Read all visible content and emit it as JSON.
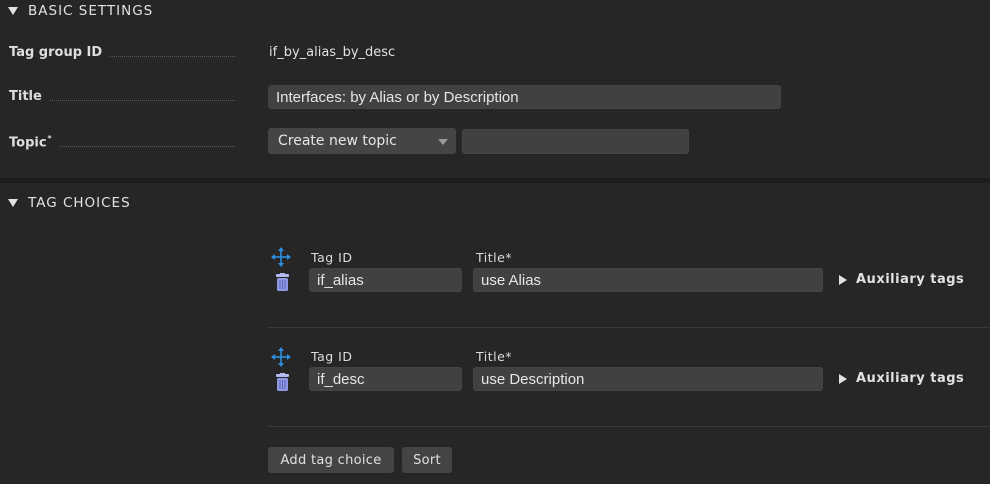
{
  "basic_settings": {
    "header": "BASIC SETTINGS",
    "tag_group_id": {
      "label": "Tag group ID",
      "value": "if_by_alias_by_desc"
    },
    "title": {
      "label": "Title",
      "value": "Interfaces: by Alias or by Description"
    },
    "topic": {
      "label": "Topic",
      "required_mark": "*",
      "select_value": "Create new topic",
      "input_value": ""
    }
  },
  "tag_choices": {
    "header": "TAG CHOICES",
    "tag_id_label": "Tag ID",
    "title_label": "Title*",
    "aux_label": "Auxiliary tags",
    "choices": [
      {
        "tag_id": "if_alias",
        "title": "use Alias"
      },
      {
        "tag_id": "if_desc",
        "title": "use Description"
      }
    ],
    "add_button": "Add tag choice",
    "sort_button": "Sort"
  },
  "icons": {
    "move": "move-arrows-icon",
    "delete": "trash-icon"
  },
  "colors": {
    "background": "#262626",
    "input_bg": "#414141",
    "accent_blue": "#2f8fe0",
    "trash": "#9aa4e8"
  }
}
